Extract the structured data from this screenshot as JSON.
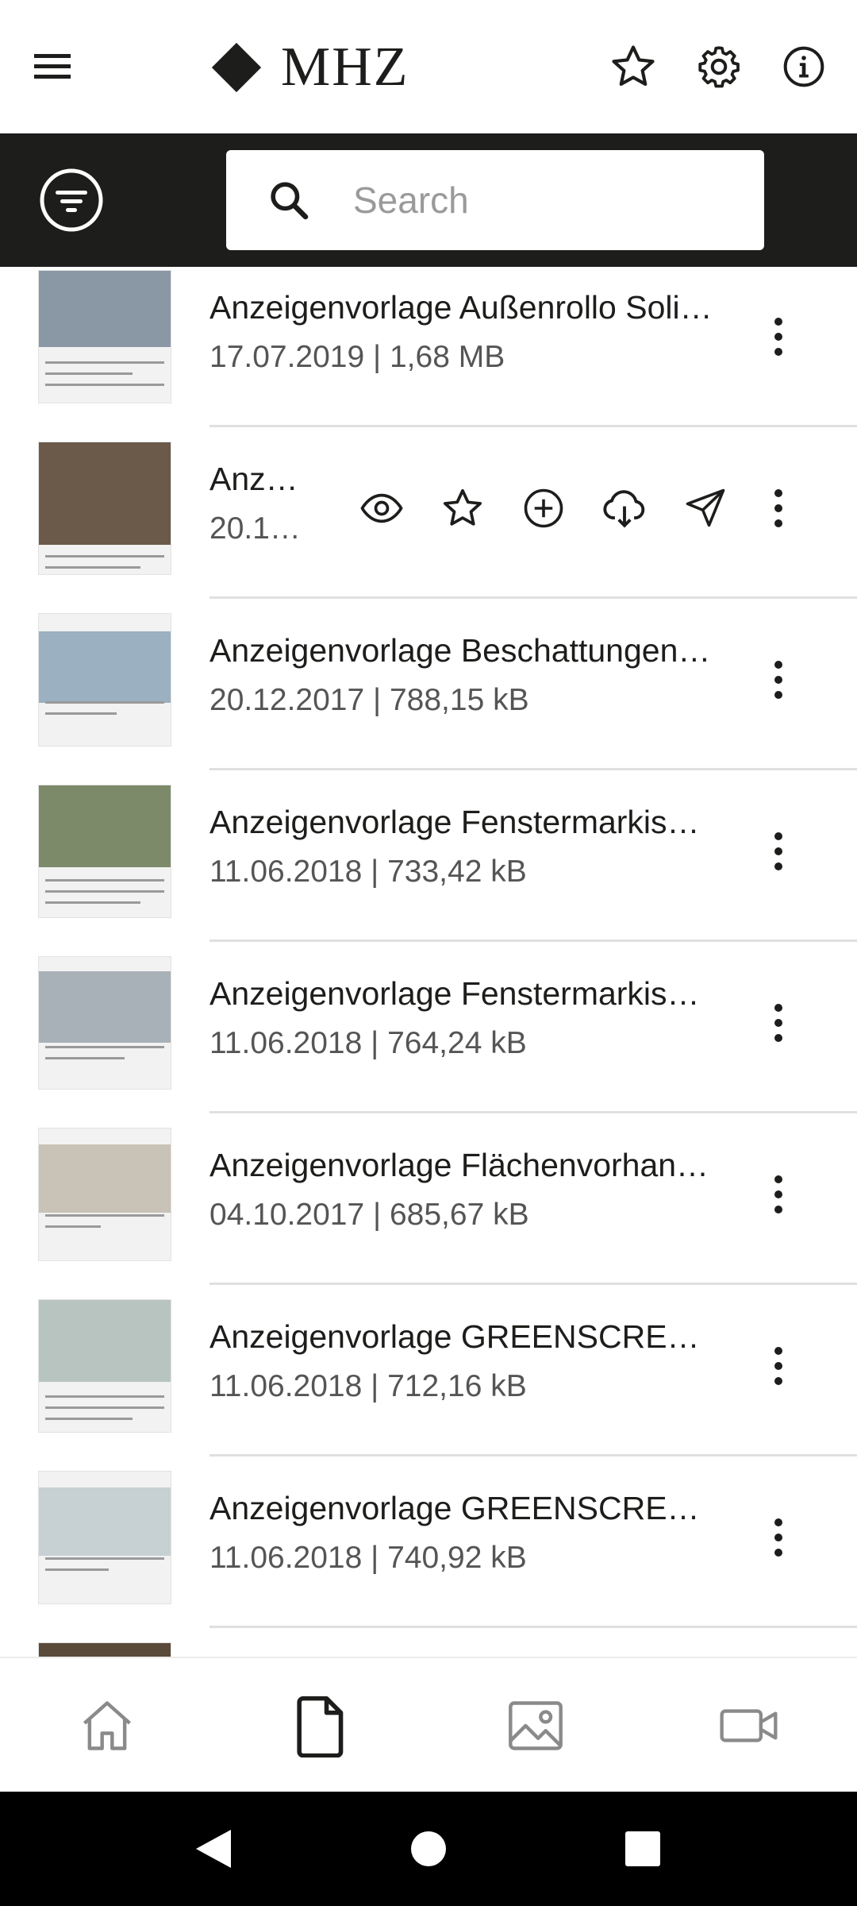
{
  "app": {
    "logo_text": "MHZ"
  },
  "header": {
    "menu_icon": "hamburger-menu-icon",
    "favorites_icon": "star-icon",
    "settings_icon": "gear-icon",
    "info_icon": "info-icon"
  },
  "search": {
    "placeholder": "Search",
    "value": "",
    "filter_icon": "filter-icon"
  },
  "documents": [
    {
      "title": "Anzeigenvorlage Außenrollo Soli…",
      "meta": "17.07.2019 | 1,68 MB",
      "thumb_color": "#8a97a5"
    },
    {
      "title": "Anze…",
      "meta": "20.1…",
      "thumb_color": "#6b5a4a",
      "expanded": true
    },
    {
      "title": "Anzeigenvorlage Beschattungen …",
      "meta": "20.12.2017 | 788,15 kB",
      "thumb_color": "#9bb0c0"
    },
    {
      "title": "Anzeigenvorlage Fenstermarkise…",
      "meta": "11.06.2018 | 733,42 kB",
      "thumb_color": "#7d8a6a"
    },
    {
      "title": "Anzeigenvorlage Fenstermarkise…",
      "meta": "11.06.2018 | 764,24 kB",
      "thumb_color": "#a9b1b8"
    },
    {
      "title": "Anzeigenvorlage Flächenvorhan…",
      "meta": "04.10.2017 | 685,67 kB",
      "thumb_color": "#c9c2b6"
    },
    {
      "title": "Anzeigenvorlage GREENSCREE…",
      "meta": "11.06.2018 | 712,16 kB",
      "thumb_color": "#b8c4c0"
    },
    {
      "title": "Anzeigenvorlage GREENSCREE…",
      "meta": "11.06.2018 | 740,92 kB",
      "thumb_color": "#c7d0d2"
    },
    {
      "title": "",
      "meta": "",
      "thumb_color": "#5a4a3a"
    }
  ],
  "row_actions": [
    "eye-icon",
    "star-icon",
    "add-circle-icon",
    "cloud-download-icon",
    "send-icon"
  ],
  "bottom_nav": [
    "home-icon",
    "document-icon",
    "image-icon",
    "video-icon"
  ],
  "bottom_nav_active": "document-icon",
  "system_nav": [
    "back-icon",
    "home-circle-icon",
    "recents-square-icon"
  ]
}
